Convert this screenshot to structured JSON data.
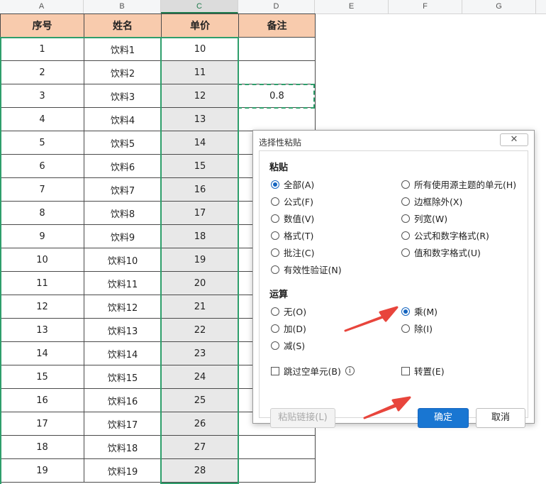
{
  "columns": [
    "A",
    "B",
    "C",
    "D",
    "E",
    "F",
    "G"
  ],
  "headers": {
    "a": "序号",
    "b": "姓名",
    "c": "单价",
    "d": "备注"
  },
  "rows": [
    {
      "a": "1",
      "b": "饮料1",
      "c": "10",
      "d": ""
    },
    {
      "a": "2",
      "b": "饮料2",
      "c": "11",
      "d": ""
    },
    {
      "a": "3",
      "b": "饮料3",
      "c": "12",
      "d": "0.8"
    },
    {
      "a": "4",
      "b": "饮料4",
      "c": "13",
      "d": ""
    },
    {
      "a": "5",
      "b": "饮料5",
      "c": "14",
      "d": ""
    },
    {
      "a": "6",
      "b": "饮料6",
      "c": "15",
      "d": ""
    },
    {
      "a": "7",
      "b": "饮料7",
      "c": "16",
      "d": ""
    },
    {
      "a": "8",
      "b": "饮料8",
      "c": "17",
      "d": ""
    },
    {
      "a": "9",
      "b": "饮料9",
      "c": "18",
      "d": ""
    },
    {
      "a": "10",
      "b": "饮料10",
      "c": "19",
      "d": ""
    },
    {
      "a": "11",
      "b": "饮料11",
      "c": "20",
      "d": ""
    },
    {
      "a": "12",
      "b": "饮料12",
      "c": "21",
      "d": ""
    },
    {
      "a": "13",
      "b": "饮料13",
      "c": "22",
      "d": ""
    },
    {
      "a": "14",
      "b": "饮料14",
      "c": "23",
      "d": ""
    },
    {
      "a": "15",
      "b": "饮料15",
      "c": "24",
      "d": ""
    },
    {
      "a": "16",
      "b": "饮料16",
      "c": "25",
      "d": ""
    },
    {
      "a": "17",
      "b": "饮料17",
      "c": "26",
      "d": ""
    },
    {
      "a": "18",
      "b": "饮料18",
      "c": "27",
      "d": ""
    },
    {
      "a": "19",
      "b": "饮料19",
      "c": "28",
      "d": ""
    }
  ],
  "dialog": {
    "title": "选择性粘贴",
    "close_glyph": "✕",
    "paste_section": "粘贴",
    "paste_left": [
      "全部(A)",
      "公式(F)",
      "数值(V)",
      "格式(T)",
      "批注(C)",
      "有效性验证(N)"
    ],
    "paste_right": [
      "所有使用源主题的单元(H)",
      "边框除外(X)",
      "列宽(W)",
      "公式和数字格式(R)",
      "值和数字格式(U)"
    ],
    "op_section": "运算",
    "op_left": [
      "无(O)",
      "加(D)",
      "减(S)"
    ],
    "op_right": [
      "乘(M)",
      "除(I)"
    ],
    "skip_blanks": "跳过空单元(B)",
    "info_glyph": "i",
    "transpose": "转置(E)",
    "paste_link_button": "粘贴链接(L)",
    "ok_button": "确定",
    "cancel_button": "取消"
  },
  "state": {
    "selected_paste": "全部(A)",
    "selected_operation": "乘(M)",
    "skip_blanks_checked": false,
    "transpose_checked": false,
    "selected_column": "C",
    "copied_cell": "D3"
  },
  "colors": {
    "header_fill": "#f8cbad",
    "selection_green": "#2e9e6b",
    "primary_blue": "#1976d2",
    "arrow_red": "#e8453c"
  }
}
